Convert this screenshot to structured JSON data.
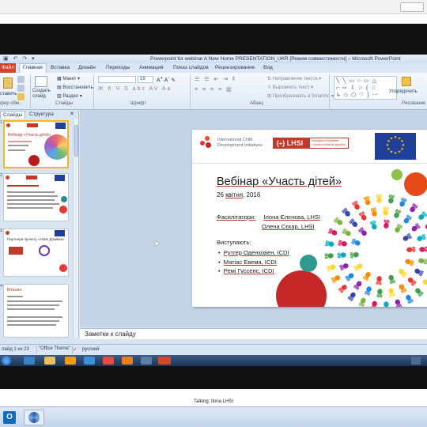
{
  "host": {
    "talking_label": "Talking: Ilona LHSI"
  },
  "ppt": {
    "window_title": "Powerpoint for webinar A New Home PRESENTATION_UKR [Режим совместимости] – Microsoft PowerPoint",
    "tabs": [
      {
        "label": "Файл",
        "active": false
      },
      {
        "label": "Главная",
        "active": true
      },
      {
        "label": "Вставка",
        "active": false
      },
      {
        "label": "Дизайн",
        "active": false
      },
      {
        "label": "Переходы",
        "active": false
      },
      {
        "label": "Анимация",
        "active": false
      },
      {
        "label": "Показ слайдов",
        "active": false
      },
      {
        "label": "Рецензирование",
        "active": false
      },
      {
        "label": "Вид",
        "active": false
      }
    ],
    "ribbon": {
      "paste_label": "ставить",
      "clipboard_group": "фер обм...",
      "new_slide_label": "Создать слайд",
      "layout_label": "Макет",
      "reset_label": "Восстановить",
      "section_label": "Раздел",
      "slides_group": "Слайды",
      "font_size": "18",
      "font_group": "Шрифт",
      "paragraph_group": "Абзац",
      "text_direction_label": "Направление текста",
      "align_text_label": "Выровнять текст",
      "convert_smartart_label": "Преобразовать в SmartArt",
      "arrange_label": "Упорядочить",
      "drawing_group": "Рисование"
    },
    "pane": {
      "tab_slides": "Слайды",
      "tab_outline": "Структура"
    },
    "thumbs": [
      {
        "num": "1",
        "title": "Вебінар «Участь дітей»"
      },
      {
        "num": "2",
        "title": ""
      },
      {
        "num": "3",
        "title": "Партнери проекту «Нове Домівка»"
      },
      {
        "num": "4",
        "title": "Вітаємо"
      }
    ],
    "notes_placeholder": "Заметки к слайду",
    "status": {
      "slide_info": "лайд 1 из 23",
      "theme": "\"Office Theme\"",
      "language": "русский"
    }
  },
  "slide": {
    "org1_line1": "International Child",
    "org1_line2": "Development Initiatives",
    "lhsi_logo": "LHSI",
    "lhsi_tagline_1": "Спеціальні ініціативи",
    "lhsi_tagline_2": "з захисту прав та здоров'я",
    "title": "Вебінар «Участь дітей»",
    "date_prefix": "26 ",
    "date_month": "квітня",
    "date_suffix": ", 2016",
    "facilitators_label": "Фасилітатори:",
    "facilitator_1": "Ілона Єлєнєва, LHSI",
    "facilitator_2": "Олена Сєкар, LHSI",
    "speakers_label": "Виступають:",
    "speakers": [
      "Рутгер Оденховен, ICDI",
      "Матіас Евема, ICDI",
      "Ремі Гуссенс, ICDI"
    ]
  },
  "colors": {
    "brand_red": "#c0392b",
    "file_tab": "#d24726",
    "ribbon_text": "#1e395b",
    "title_red": "#c0392b",
    "eu_blue": "#1f3f99",
    "eu_gold": "#ffcc00"
  }
}
